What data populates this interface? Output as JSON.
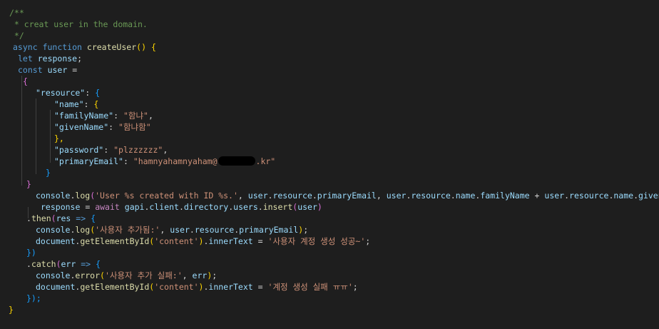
{
  "code": {
    "tokens": {
      "c1": "/**",
      "c2": " * creat user in the domain.",
      "c3": " */",
      "async": "async",
      "function": "function",
      "createUser": "createUser",
      "paren_open": "(",
      "paren_close": ")",
      "parens_empty": "()",
      "brace_open": "{",
      "brace_close": "}",
      "let": "let",
      "const": "const",
      "response": "response",
      "user": "user",
      "semicolon": ";",
      "equals": "=",
      "colon": ":",
      "comma": ",",
      "dot": ".",
      "plus": "+",
      "arrow": "=>",
      "k_resource": "\"resource\"",
      "k_name": "\"name\"",
      "k_familyName": "\"familyName\"",
      "k_givenName": "\"givenName\"",
      "k_password": "\"password\"",
      "k_primaryEmail": "\"primaryEmail\"",
      "v_familyName": "\"함냐\"",
      "v_givenName": "\"함냐함\"",
      "v_password": "\"plzzzzzz\"",
      "v_email_start": "\"hamnyahamnyaham@",
      "v_email_end": ".kr\"",
      "brace_close_comma": "},",
      "console": "console",
      "log": "log",
      "error": "error",
      "s_log1": "'User %s created with ID %s.'",
      "resource": "resource",
      "primaryEmail": "primaryEmail",
      "name": "name",
      "familyName": "familyName",
      "givenName": "givenName",
      "await": "await",
      "gapi": "gapi",
      "client": "client",
      "directory": "directory",
      "users": "users",
      "insert": "insert",
      "then": "then",
      "res": "res",
      "s_log2": "'사용자 추가됨:'",
      "document": "document",
      "getElementById": "getElementById",
      "s_content": "'content'",
      "innerText": "innerText",
      "s_success": "'사용자 계정 생성 성공~'",
      "catch": "catch",
      "err": "err",
      "s_err1": "'사용자 추가 실패:'",
      "s_fail": "'계정 생성 실패 ㅠㅠ'",
      "close_paren_brace": "})",
      "close_paren_brace_semi": "});"
    }
  },
  "colors": {
    "background": "#1e1e1e",
    "comment": "#6a9955",
    "keyword": "#569cd6",
    "control": "#c586c0",
    "function": "#dcdcaa",
    "variable": "#9cdcfe",
    "string": "#ce9178",
    "bracket_level1": "#ffd700",
    "bracket_level2": "#da70d6",
    "bracket_level3": "#179fff",
    "default_text": "#d4d4d4"
  }
}
